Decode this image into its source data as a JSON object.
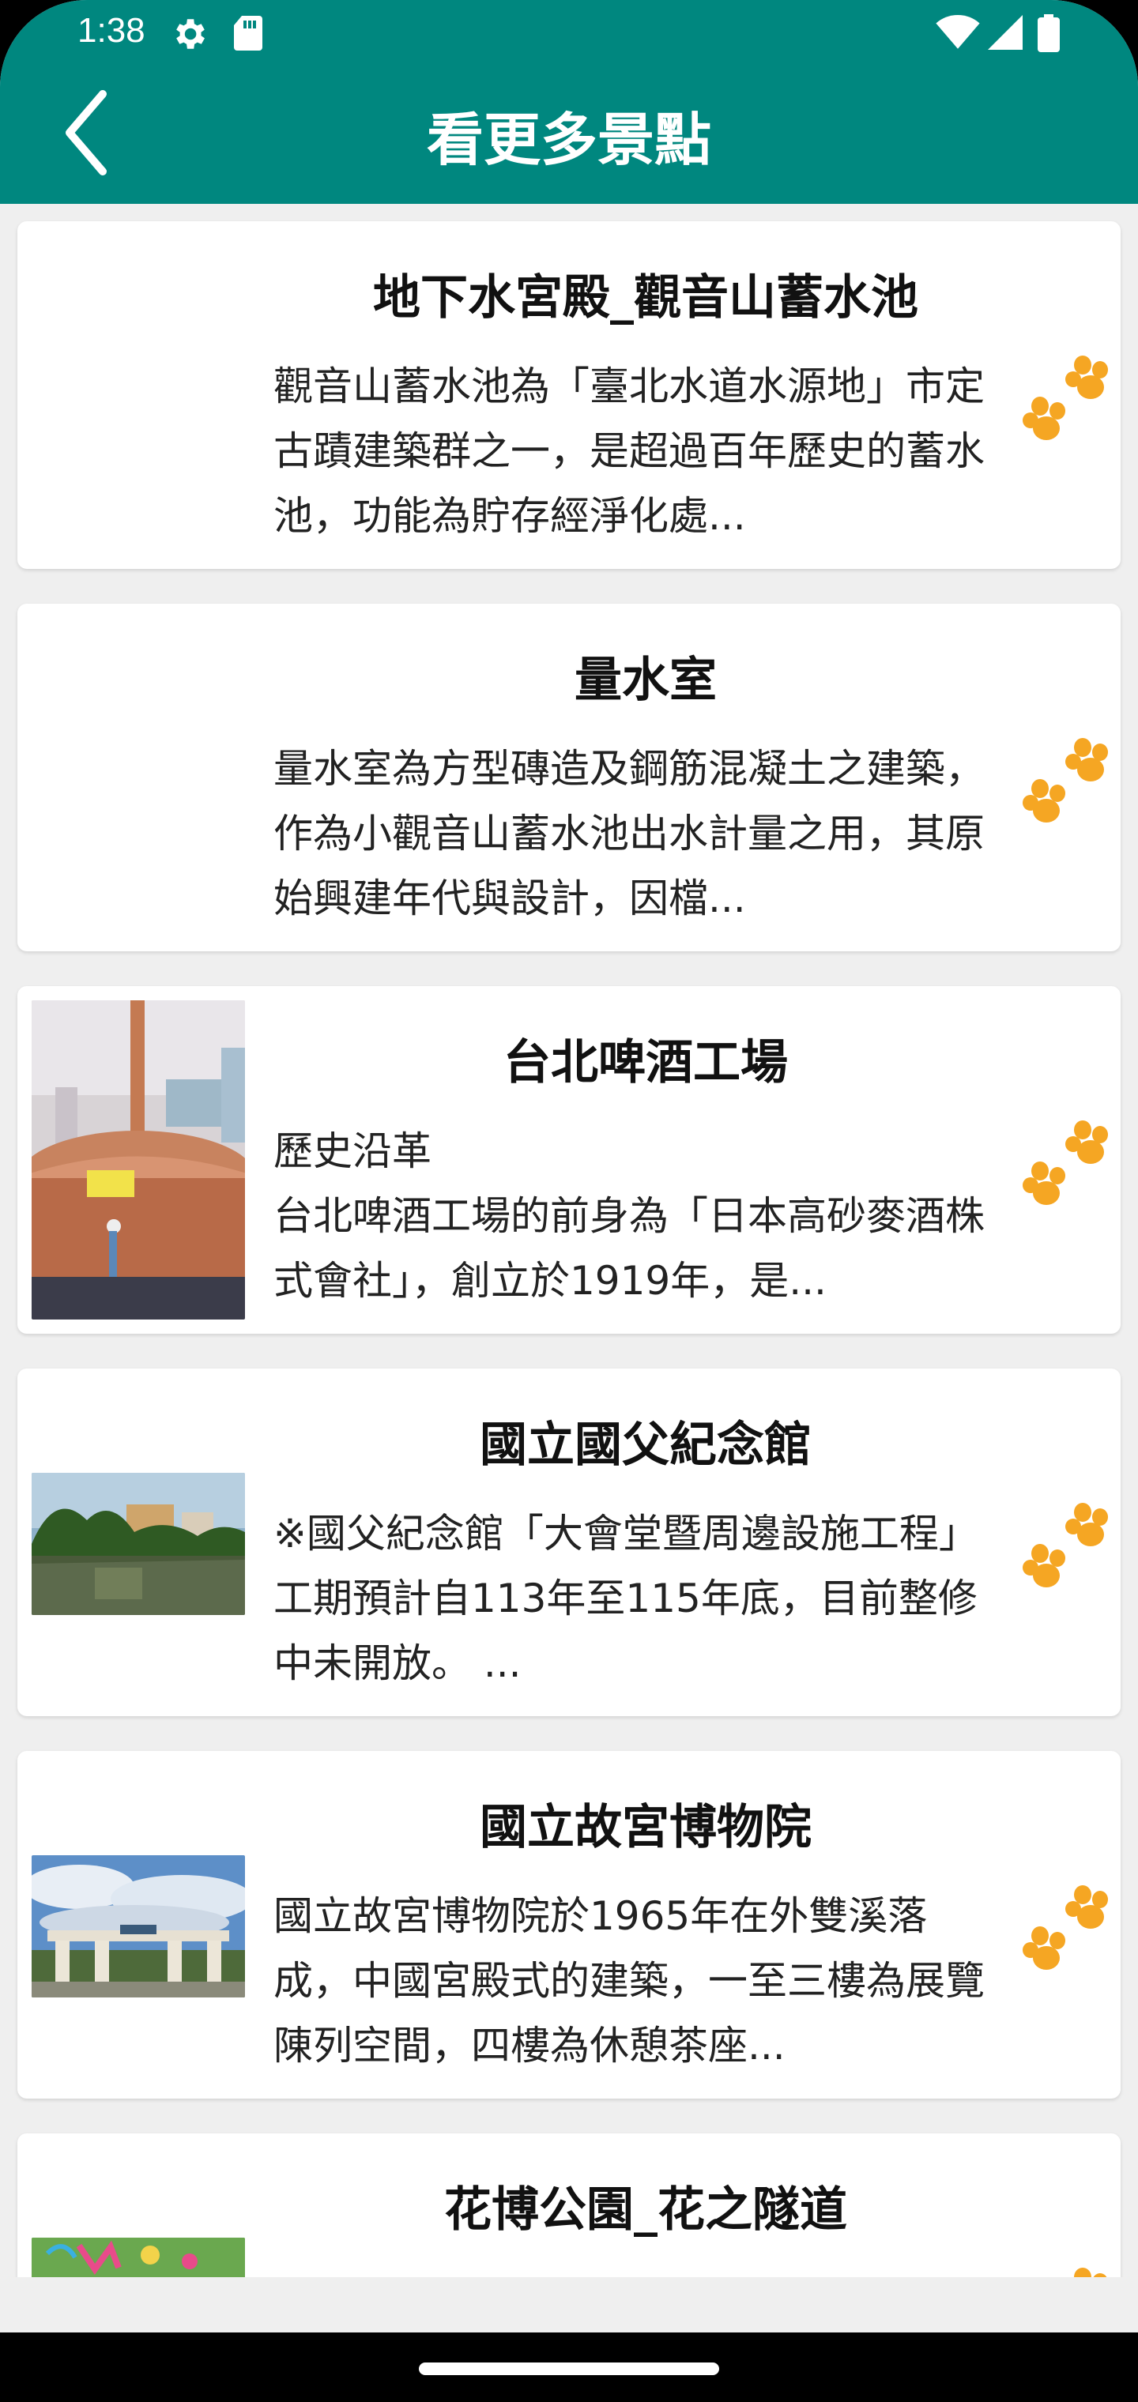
{
  "status_bar": {
    "time": "1:38",
    "icons": [
      "settings-gear-icon",
      "sd-card-icon",
      "wifi-icon",
      "cellular-signal-icon",
      "battery-icon"
    ]
  },
  "header": {
    "title": "看更多景點",
    "back_icon": "chevron-left-icon",
    "background_color": "#00877f"
  },
  "accent_color": "#f5a623",
  "attractions": [
    {
      "title": "地下水宮殿_觀音山蓄水池",
      "description": "觀音山蓄水池為「臺北水道水源地」市定古蹟建築群之一，是超過百年歷史的蓄水池，功能為貯存經淨化處...",
      "image": "none",
      "icon": "paw-icon"
    },
    {
      "title": "量水室",
      "description": "量水室為方型磚造及鋼筋混凝土之建築，作為小觀音山蓄水池出水計量之用，其原始興建年代與設計，因檔...",
      "image": "none",
      "icon": "paw-icon"
    },
    {
      "title": "台北啤酒工場",
      "description": "歷史沿革\n台北啤酒工場的前身為「日本高砂麥酒株式會社」，創立於1919年，是...",
      "image": "copper-brewing-tank-photo",
      "icon": "paw-icon"
    },
    {
      "title": "國立國父紀念館",
      "description": "※國父紀念館「大會堂暨周邊設施工程」工期預計自113年至115年底，目前整修中未開放。 ...",
      "image": "lake-and-trees-photo",
      "icon": "paw-icon"
    },
    {
      "title": "國立故宮博物院",
      "description": "國立故宮博物院於1965年在外雙溪落成，中國宮殿式的建築，一至三樓為展覽陳列空間，四樓為休憩茶座...",
      "image": "museum-gate-photo",
      "icon": "paw-icon"
    },
    {
      "title": "花博公園_花之隧道",
      "description": "",
      "image": "flower-tunnel-photo",
      "icon": "paw-icon"
    }
  ]
}
